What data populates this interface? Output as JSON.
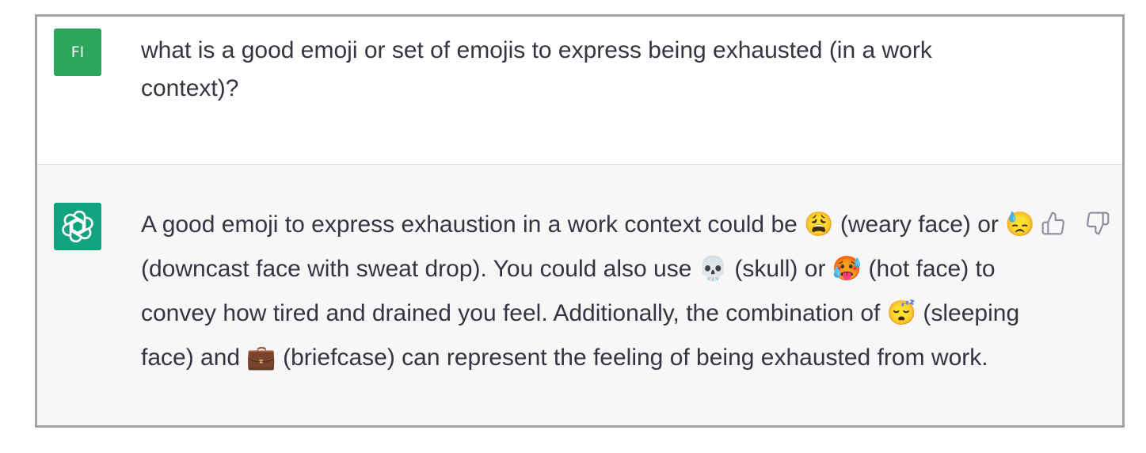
{
  "user_message": {
    "avatar_initials": "FI",
    "text": "what is a good emoji or set of emojis to express being exhausted (in a work context)?"
  },
  "assistant_message": {
    "avatar_icon": "openai-logo-icon",
    "text": "A good emoji to express exhaustion in a work context could be 😩 (weary face) or 😓 (downcast face with sweat drop). You could also use 💀 (skull) or 🥵 (hot face) to convey how tired and drained you feel. Additionally, the combination of 😴 (sleeping face) and 💼 (briefcase) can represent the feeling of being exhausted from work."
  },
  "feedback": {
    "thumbs_up_icon": "thumbs-up-icon",
    "thumbs_down_icon": "thumbs-down-icon"
  },
  "colors": {
    "user_avatar": "#2ba65a",
    "assistant_avatar": "#10a37f",
    "assistant_background": "#f7f7f8",
    "text": "#343541",
    "frame_border": "#a3a3a3"
  }
}
